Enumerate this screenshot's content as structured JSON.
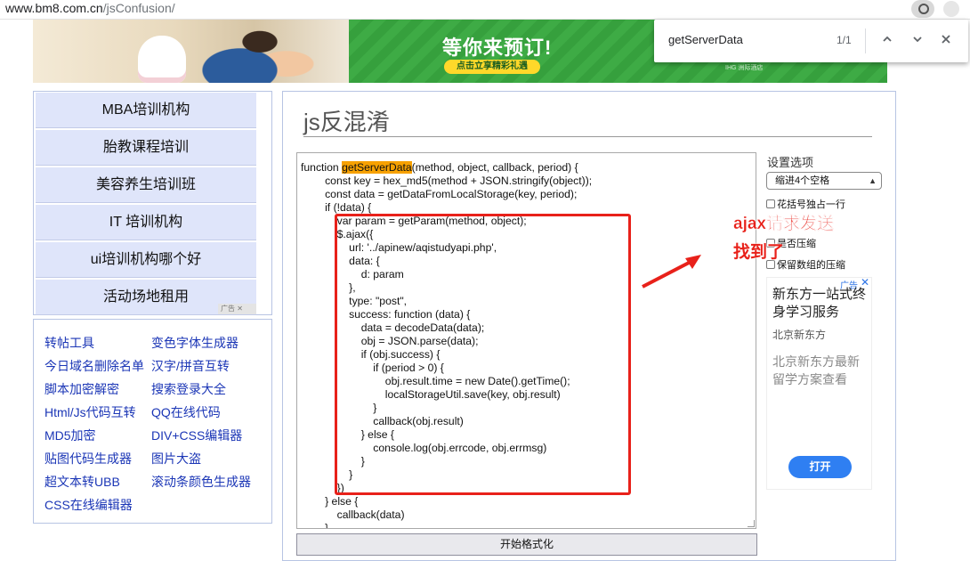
{
  "browser": {
    "url_host": "www.bm8.com.cn",
    "url_path": "/jsConfusion/",
    "find": {
      "query": "getServerData",
      "count": "1/1"
    }
  },
  "banner": {
    "headline": "等你来预订!",
    "cta": "点击立享精彩礼遇",
    "mark": "IHG 洲际酒店"
  },
  "left_nav": {
    "items": [
      "MBA培训机构",
      "胎教课程培训",
      "美容养生培训班",
      "IT 培训机构",
      "ui培训机构哪个好",
      "活动场地租用"
    ],
    "ad_tag": "广告"
  },
  "link_grid": {
    "col1": [
      "转帖工具",
      "今日域名删除名单",
      "脚本加密解密",
      "Html/Js代码互转",
      "MD5加密",
      "贴图代码生成器",
      "超文本转UBB",
      "CSS在线编辑器"
    ],
    "col2": [
      "变色字体生成器",
      "汉字/拼音互转",
      "搜索登录大全",
      "QQ在线代码",
      "DIV+CSS编辑器",
      "图片大盗",
      "滚动条颜色生成器"
    ]
  },
  "main": {
    "title": "js反混淆",
    "format_button": "开始格式化",
    "code": {
      "line0_prefix": "function ",
      "line0_highlight": "getServerData",
      "line0_suffix": "(method, object, callback, period) {",
      "lines": [
        "        const key = hex_md5(method + JSON.stringify(object));",
        "        const data = getDataFromLocalStorage(key, period);",
        "        if (!data) {",
        "            var param = getParam(method, object);",
        "            $.ajax({",
        "                url: '../apinew/aqistudyapi.php',",
        "                data: {",
        "                    d: param",
        "                },",
        "                type: \"post\",",
        "                success: function (data) {",
        "                    data = decodeData(data);",
        "                    obj = JSON.parse(data);",
        "                    if (obj.success) {",
        "                        if (period > 0) {",
        "                            obj.result.time = new Date().getTime();",
        "                            localStorageUtil.save(key, obj.result)",
        "                        }",
        "                        callback(obj.result)",
        "                    } else {",
        "                        console.log(obj.errcode, obj.errmsg)",
        "                    }",
        "                }",
        "            })",
        "        } else {",
        "            callback(data)",
        "        }"
      ]
    }
  },
  "settings": {
    "title": "设置选项",
    "indent_value": "缩进4个空格",
    "options": [
      "花括号独占一行",
      "是否压缩",
      "保留数组的压缩"
    ]
  },
  "side_ad": {
    "badge": "广告",
    "headline": "新东方一站式终身学习服务",
    "brand": "北京新东方",
    "body": "北京新东方最新留学方案查看",
    "open": "打开"
  },
  "annotation": {
    "line1": "ajax请求发送",
    "line2": "找到了",
    "color": "#e8211a"
  }
}
